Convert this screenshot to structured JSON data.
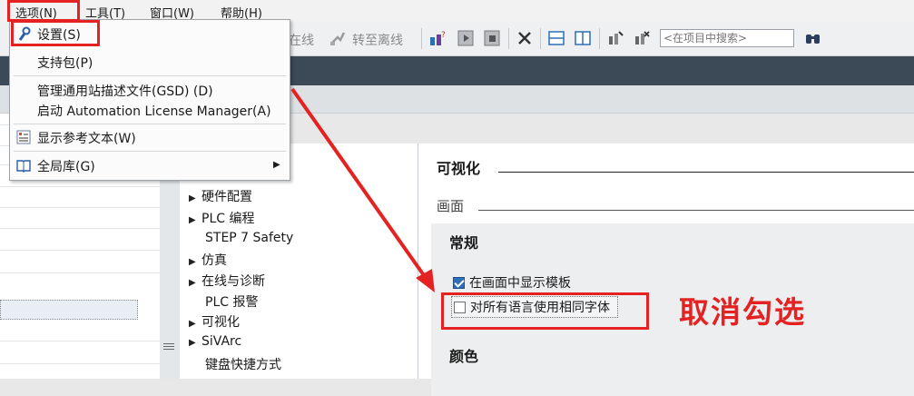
{
  "menubar": {
    "items": [
      {
        "label": "选项(N)"
      },
      {
        "label": "工具(T)"
      },
      {
        "label": "窗口(W)"
      },
      {
        "label": "帮助(H)"
      }
    ]
  },
  "toolbar": {
    "go_online": "在线",
    "go_offline": "转至离线",
    "search_placeholder": "<在项目中搜索>"
  },
  "options_menu": {
    "settings": "设置(S)",
    "support_packages": "支持包(P)",
    "manage_gsd": "管理通用站描述文件(GSD) (D)",
    "start_alm": "启动 Automation License Manager(A)",
    "show_reference_text": "显示参考文本(W)",
    "global_libraries": "全局库(G)"
  },
  "nav_tree": {
    "items": [
      {
        "label": "硬件配置",
        "expandable": true
      },
      {
        "label": "PLC 编程",
        "expandable": true
      },
      {
        "label": "STEP 7 Safety",
        "expandable": false
      },
      {
        "label": "仿真",
        "expandable": true
      },
      {
        "label": "在线与诊断",
        "expandable": true
      },
      {
        "label": "PLC 报警",
        "expandable": false
      },
      {
        "label": "可视化",
        "expandable": true
      },
      {
        "label": "SiVArc",
        "expandable": true
      },
      {
        "label": "键盘快捷方式",
        "expandable": false
      }
    ]
  },
  "settings_panel": {
    "section_title": "可视化",
    "subsection_label": "画面",
    "general_title": "常规",
    "show_templates_label": "在画面中显示模板",
    "show_templates_checked": true,
    "same_font_label": "对所有语言使用相同字体",
    "same_font_checked": false,
    "color_title": "颜色"
  },
  "annotation": {
    "note": "取消勾选",
    "color": "#e42222"
  },
  "colors": {
    "title_bar": "#3c4a58",
    "checkbox_checked": "#2f6fb5"
  }
}
